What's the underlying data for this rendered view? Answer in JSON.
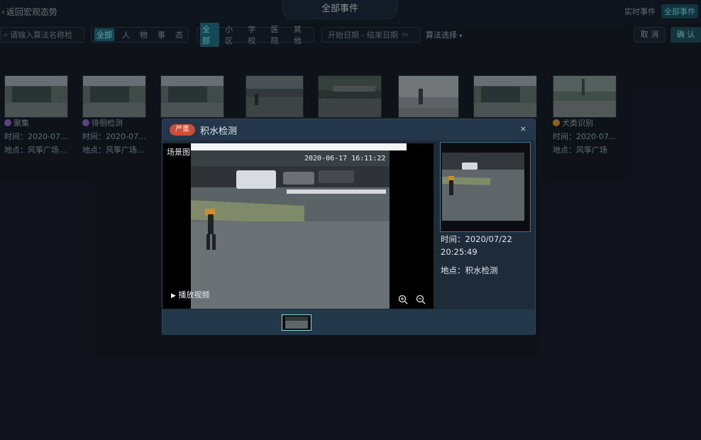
{
  "header": {
    "back_label": "返回宏观态势",
    "title": "全部事件",
    "mode_realtime": "实时事件",
    "mode_all": "全部事件"
  },
  "filters": {
    "search_placeholder": "请输入算法名称检",
    "type_tags": [
      "全部",
      "人",
      "物",
      "事",
      "态"
    ],
    "place_tags": [
      "全部",
      "小区",
      "学校",
      "医院",
      "其他"
    ],
    "date_label": "开始日期 - 结束日期",
    "algo_label": "算法选择",
    "cancel_label": "取 消",
    "confirm_label": "确 认"
  },
  "cards": [
    {
      "name": "聚集",
      "time": "时间：2020-07...",
      "place": "地点：风筝广场...",
      "color": "#8a5bc6"
    },
    {
      "name": "徘徊检测",
      "time": "时间：2020-07...",
      "place": "地点：风筝广场...",
      "color": "#8a5bc6"
    },
    {
      "name": "",
      "time": "",
      "place": "",
      "color": ""
    },
    {
      "name": "",
      "time": "",
      "place": "",
      "color": ""
    },
    {
      "name": "",
      "time": "",
      "place": "",
      "color": ""
    },
    {
      "name": "",
      "time": "",
      "place": "",
      "color": ""
    },
    {
      "name": "",
      "time": "",
      "place": "",
      "color": ""
    },
    {
      "name": "犬类识别",
      "time": "时间：2020-07...",
      "place": "地点：风筝广场",
      "color": "#d98a2a"
    }
  ],
  "modal": {
    "severity": "严重",
    "title": "积水检测",
    "close_icon": "×",
    "scene_label": "场景图",
    "video_timestamp": "2020-06-17 16:11:22",
    "play_label": "播放视频",
    "time_label": "时间：2020/07/22",
    "time_value": "20:25:49",
    "place_label": "地点：积水检测"
  },
  "colors": {
    "accent": "#1a6a78",
    "severity": "#c94c3c",
    "background": "#11161e"
  }
}
